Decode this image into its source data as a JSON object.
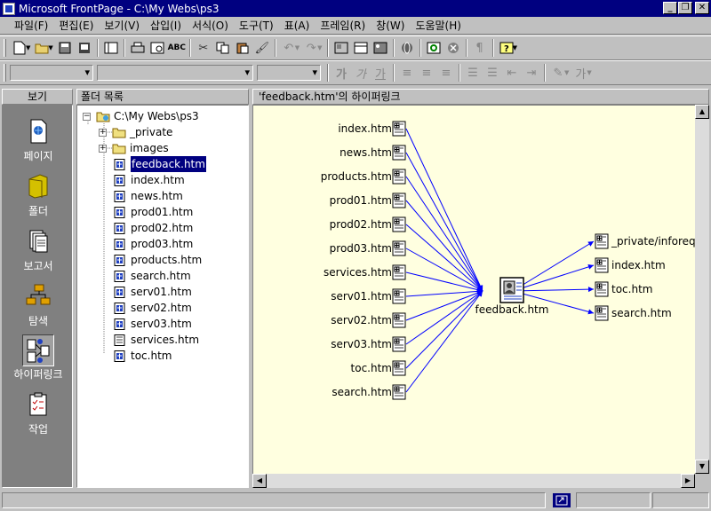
{
  "window": {
    "title": "Microsoft FrontPage - C:\\My Webs\\ps3",
    "minimize_icon": "minimize-icon",
    "restore_icon": "restore-icon",
    "close_icon": "close-icon"
  },
  "menu": [
    {
      "label": "파일(F)"
    },
    {
      "label": "편집(E)"
    },
    {
      "label": "보기(V)"
    },
    {
      "label": "삽입(I)"
    },
    {
      "label": "서식(O)"
    },
    {
      "label": "도구(T)"
    },
    {
      "label": "표(A)"
    },
    {
      "label": "프레임(R)"
    },
    {
      "label": "창(W)"
    },
    {
      "label": "도움말(H)"
    }
  ],
  "views": {
    "header": "보기",
    "items": [
      {
        "label": "페이지",
        "icon": "page-icon"
      },
      {
        "label": "폴더",
        "icon": "folder-icon"
      },
      {
        "label": "보고서",
        "icon": "reports-icon"
      },
      {
        "label": "탐색",
        "icon": "navigation-icon"
      },
      {
        "label": "하이퍼링크",
        "icon": "hyperlinks-icon",
        "active": true
      },
      {
        "label": "작업",
        "icon": "tasks-icon"
      }
    ]
  },
  "folders": {
    "header": "폴더 목록",
    "root": "C:\\My Webs\\ps3",
    "folders": [
      "_private",
      "images"
    ],
    "files": [
      "feedback.htm",
      "index.htm",
      "news.htm",
      "prod01.htm",
      "prod02.htm",
      "prod03.htm",
      "products.htm",
      "search.htm",
      "serv01.htm",
      "serv02.htm",
      "serv03.htm",
      "services.htm",
      "toc.htm"
    ],
    "selected": "feedback.htm"
  },
  "hyperlinks": {
    "header": "'feedback.htm'의 하이퍼링크",
    "center": "feedback.htm",
    "incoming": [
      "index.htm",
      "news.htm",
      "products.htm",
      "prod01.htm",
      "prod02.htm",
      "prod03.htm",
      "services.htm",
      "serv01.htm",
      "serv02.htm",
      "serv03.htm",
      "toc.htm",
      "search.htm"
    ],
    "outgoing": [
      "_private/inforeq.t",
      "index.htm",
      "toc.htm",
      "search.htm"
    ],
    "link_color": "#0000ff"
  },
  "colors": {
    "titlebar": "#000080",
    "selection": "#000080",
    "canvas": "#ffffe0"
  }
}
